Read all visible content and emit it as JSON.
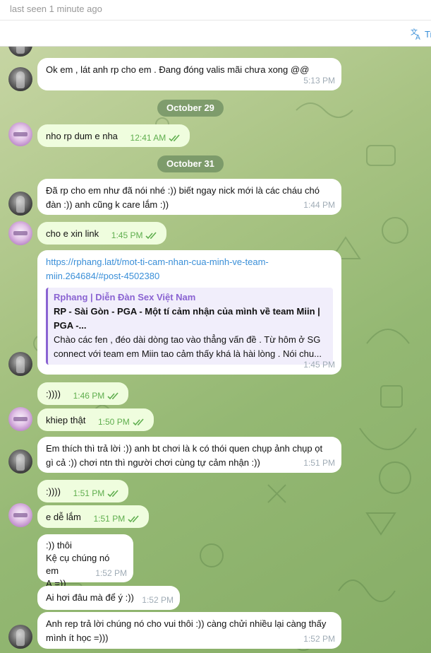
{
  "header": {
    "status": "last seen 1 minute ago"
  },
  "translate": {
    "label": "Tr",
    "icon": "translate-icon"
  },
  "dates": [
    "October 29",
    "October 31"
  ],
  "messages": [
    {
      "text": "Ok em , lát anh rp cho em . Đang đóng valis mãi chưa xong @@",
      "time": "5:13 PM",
      "dir": "in"
    },
    {
      "text": "nho rp dum e nha",
      "time": "12:41 AM",
      "dir": "out"
    },
    {
      "text": "Đã rp cho em như đã nói nhé :)) biết ngay nick mới là các cháu chó\nđàn :)) anh cũng k care lắm :))",
      "time": "1:44 PM",
      "dir": "in"
    },
    {
      "text": "cho e xin link",
      "time": "1:45 PM",
      "dir": "out"
    },
    {
      "link": "https://rphang.lat/t/mot-ti-cam-nhan-cua-minh-ve-team-\nmiin.264684/#post-4502380",
      "preview": {
        "site": "Rphang | Diễn Đàn Sex Việt Nam",
        "title": "RP - Sài Gòn - PGA - Một tí cảm nhận của mình về team Miin |\nPGA -...",
        "body": "Chào các fen , đéo dài dòng tao vào thẳng vấn đề . Từ hôm ở SG\nconnect với team em Miin tao cảm thấy khá là hài lòng . Nói chu..."
      },
      "time": "1:45 PM",
      "dir": "in"
    },
    {
      "text": ":))))",
      "time": "1:46 PM",
      "dir": "out"
    },
    {
      "text": "khiep thật",
      "time": "1:50 PM",
      "dir": "out"
    },
    {
      "text": "Em thích thì trả lời :)) anh bt chơi là k có thói quen chụp ảnh chụp ọt\ngì cả :)) chơi ntn thì người chơi cùng tự cảm nhận :))",
      "time": "1:51 PM",
      "dir": "in"
    },
    {
      "text": ":))))",
      "time": "1:51 PM",
      "dir": "out"
    },
    {
      "text": "e dễ lắm",
      "time": "1:51 PM",
      "dir": "out"
    },
    {
      "text": ":)) thôi\nKệ cụ chúng nó em\nẠ =))",
      "time": "1:52 PM",
      "dir": "in"
    },
    {
      "text": "Ai hơi đâu mà để ý :))",
      "time": "1:52 PM",
      "dir": "in"
    },
    {
      "text": "Anh rep trả lời chúng nó cho vui thôi :)) càng chửi nhiều lại càng thấy\nmình ít học =)))",
      "time": "1:52 PM",
      "dir": "in"
    }
  ],
  "colors": {
    "incoming": "#ffffff",
    "outgoing": "#effdde",
    "link": "#3a8fd8",
    "preview_accent": "#8a63d2",
    "date_pill": "#6c8c60"
  }
}
